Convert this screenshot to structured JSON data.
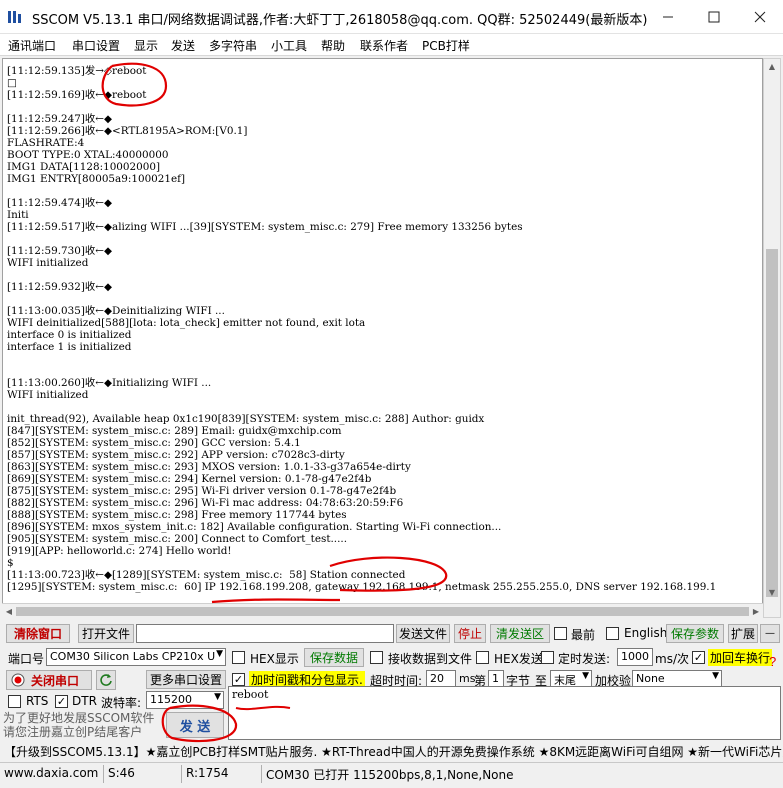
{
  "window": {
    "title": "SSCOM V5.13.1 串口/网络数据调试器,作者:大虾丁丁,2618058@qq.com. QQ群: 52502449(最新版本)"
  },
  "menu": [
    "通讯端口",
    "串口设置",
    "显示",
    "发送",
    "多字符串",
    "小工具",
    "帮助",
    "联系作者",
    "PCB打样"
  ],
  "log_lines": [
    "[11:12:59.135]发→◇reboot",
    "□",
    "[11:12:59.169]收←◆reboot",
    "",
    "[11:12:59.247]收←◆",
    "[11:12:59.266]收←◆<RTL8195A>ROM:[V0.1]",
    "FLASHRATE:4",
    "BOOT TYPE:0 XTAL:40000000",
    "IMG1 DATA[1128:10002000]",
    "IMG1 ENTRY[80005a9:100021ef]",
    "",
    "[11:12:59.474]收←◆",
    "Initi",
    "[11:12:59.517]收←◆alizing WIFI ...[39][SYSTEM: system_misc.c: 279] Free memory 133256 bytes",
    "",
    "[11:12:59.730]收←◆",
    "WIFI initialized",
    "",
    "[11:12:59.932]收←◆",
    "",
    "[11:13:00.035]收←◆Deinitializing WIFI ...",
    "WIFI deinitialized[588][lota: lota_check] emitter not found, exit lota",
    "interface 0 is initialized",
    "interface 1 is initialized",
    "",
    "",
    "[11:13:00.260]收←◆Initializing WIFI ...",
    "WIFI initialized",
    "",
    "init_thread(92), Available heap 0x1c190[839][SYSTEM: system_misc.c: 288] Author: guidx",
    "[847][SYSTEM: system_misc.c: 289] Email: guidx@mxchip.com",
    "[852][SYSTEM: system_misc.c: 290] GCC version: 5.4.1",
    "[857][SYSTEM: system_misc.c: 292] APP version: c7028c3-dirty",
    "[863][SYSTEM: system_misc.c: 293] MXOS version: 1.0.1-33-g37a654e-dirty",
    "[869][SYSTEM: system_misc.c: 294] Kernel version: 0.1-78-g47e2f4b",
    "[875][SYSTEM: system_misc.c: 295] Wi-Fi driver version 0.1-78-g47e2f4b",
    "[882][SYSTEM: system_misc.c: 296] Wi-Fi mac address: 04:78:63:20:59:F6",
    "[888][SYSTEM: system_misc.c: 298] Free memory 117744 bytes",
    "[896][SYSTEM: mxos_system_init.c: 182] Available configuration. Starting Wi-Fi connection...",
    "[905][SYSTEM: system_misc.c: 200] Connect to Comfort_test.....",
    "[919][APP: helloworld.c: 274] Hello world!",
    "$",
    "[11:13:00.723]收←◆[1289][SYSTEM: system_misc.c:  58] Station connected",
    "[1295][SYSTEM: system_misc.c:  60] IP 192.168.199.208, gateway 192.168.199.1, netmask 255.255.255.0, DNS server 192.168.199.1"
  ],
  "toolbar": {
    "clear_window": "清除窗口",
    "open_file": "打开文件",
    "send_file": "发送文件",
    "stop": "停止",
    "clear_send": "清发送区",
    "topmost": "最前",
    "english": "English",
    "save_params": "保存参数",
    "expand": "扩展",
    "minus": "—"
  },
  "port": {
    "label": "端口号",
    "value": "COM30 Silicon Labs CP210x U",
    "close_port": "关闭串口",
    "more_settings": "更多串口设置",
    "rts": "RTS",
    "dtr": "DTR",
    "baud_label": "波特率:",
    "baud_value": "115200"
  },
  "options": {
    "hex_display": "HEX显示",
    "save_data": "保存数据",
    "recv_to_file": "接收数据到文件",
    "hex_send": "HEX发送",
    "timed_send": "定时发送:",
    "interval_value": "1000",
    "interval_unit": "ms/次",
    "append_crlf": "加回车换行",
    "timestamp": "加时间戳和分包显示.",
    "timeout_label": "超时时间:",
    "timeout_value": "20",
    "timeout_unit": "ms",
    "nth_label": "第",
    "nth_value": "1",
    "byte_label": "字节",
    "to_label": "至",
    "to_value": "末尾",
    "checksum_label": "加校验",
    "checksum_value": "None"
  },
  "send": {
    "text": "reboot",
    "button": "发 送"
  },
  "promo": "为了更好地发展SSCOM软件\n请您注册嘉立创P结尾客户",
  "ticker": "【升级到SSCOM5.13.1】★嘉立创PCB打样SMT贴片服务. ★RT-Thread中国人的开源免费操作系统 ★8KM远距离WiFi可自组网 ★新一代WiFi芯片兼容",
  "statusbar": {
    "website": "www.daxia.com",
    "sent": "S:46",
    "received": "R:1754",
    "port_status": "COM30 已打开  115200bps,8,1,None,None"
  },
  "colors": {
    "accent_red": "#c00000",
    "accent_green": "#007a00",
    "annotation_red": "#e00000"
  }
}
